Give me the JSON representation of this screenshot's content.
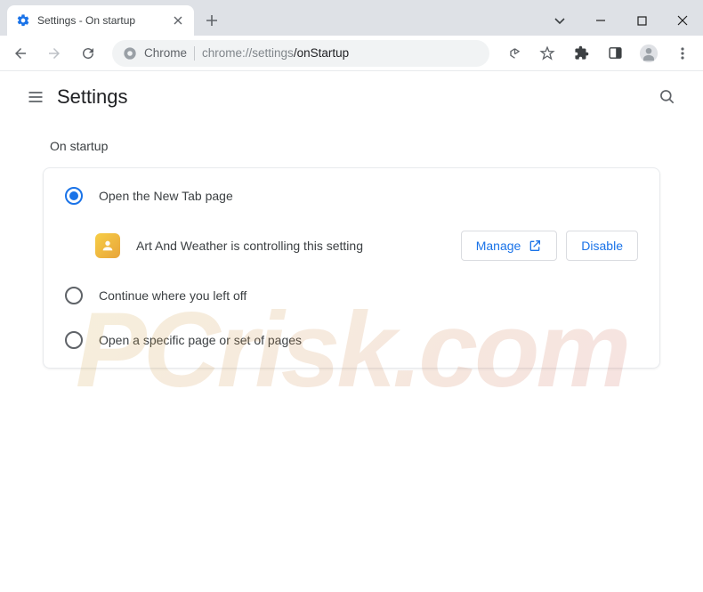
{
  "window": {
    "tab_title": "Settings - On startup"
  },
  "omnibox": {
    "origin": "Chrome",
    "path_prefix": "chrome://settings",
    "path_suffix": "/onStartup"
  },
  "settings": {
    "title": "Settings",
    "section_title": "On startup",
    "options": {
      "new_tab": "Open the New Tab page",
      "continue": "Continue where you left off",
      "specific": "Open a specific page or set of pages"
    },
    "extension_notice": "Art And Weather is controlling this setting",
    "manage_btn": "Manage",
    "disable_btn": "Disable"
  },
  "watermark": "PCrisk.com"
}
